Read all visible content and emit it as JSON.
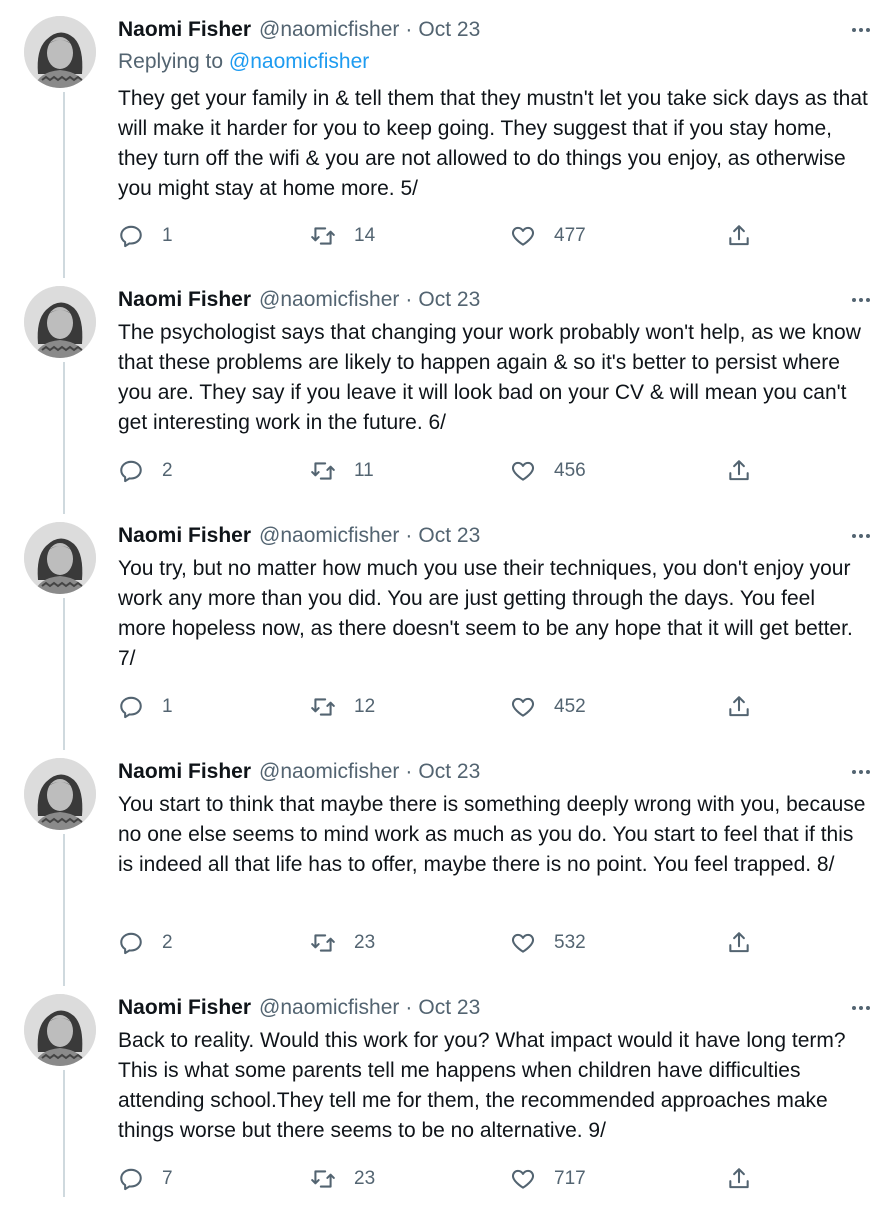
{
  "tweets": [
    {
      "name": "Naomi Fisher",
      "handle": "@naomicfisher",
      "separator": "·",
      "date": "Oct 23",
      "replying_label": "Replying to",
      "replying_handle": "@naomicfisher",
      "text": "They get your family in & tell them that they mustn't let you take sick days as that will make it harder for you to keep going. They suggest that if you stay home, they turn off the wifi & you are not allowed to do things you enjoy, as otherwise you might stay at home more. 5/",
      "replies": "1",
      "retweets": "14",
      "likes": "477"
    },
    {
      "name": "Naomi Fisher",
      "handle": "@naomicfisher",
      "separator": "·",
      "date": "Oct 23",
      "text": "The psychologist says that changing your work probably won't help, as we know that these problems are likely to happen again & so it's better to persist where you are. They say if you leave it will look bad on your CV & will mean you can't get interesting work in the future. 6/",
      "replies": "2",
      "retweets": "11",
      "likes": "456"
    },
    {
      "name": "Naomi Fisher",
      "handle": "@naomicfisher",
      "separator": "·",
      "date": "Oct 23",
      "text": "You try, but no matter how much you use their techniques, you don't enjoy your work any more than you did. You are just getting through the days. You feel more hopeless now, as there doesn't seem to be any hope that it will get better. 7/",
      "replies": "1",
      "retweets": "12",
      "likes": "452"
    },
    {
      "name": "Naomi Fisher",
      "handle": "@naomicfisher",
      "separator": "·",
      "date": "Oct 23",
      "text": "You start to think that maybe there is something deeply wrong with you, because no one else seems to mind work as much as you do. You start to feel that if this is indeed all that life has to offer, maybe there is no point. You feel trapped. 8/",
      "replies": "2",
      "retweets": "23",
      "likes": "532"
    },
    {
      "name": "Naomi Fisher",
      "handle": "@naomicfisher",
      "separator": "·",
      "date": "Oct 23",
      "text": "Back to reality. Would this work for you? What impact would it have long term? This is what some parents tell me happens when children have difficulties attending school.They tell me for them, the recommended approaches make things worse but there seems to be no alternative. 9/",
      "replies": "7",
      "retweets": "23",
      "likes": "717"
    }
  ],
  "icons": {
    "more": "more-horizontal-icon",
    "reply": "reply-bubble-icon",
    "retweet": "retweet-icon",
    "like": "heart-icon",
    "share": "share-upload-icon"
  },
  "colors": {
    "text": "#0f1419",
    "muted": "#536471",
    "link": "#1d9bf0",
    "thread_line": "#cfd9de"
  }
}
